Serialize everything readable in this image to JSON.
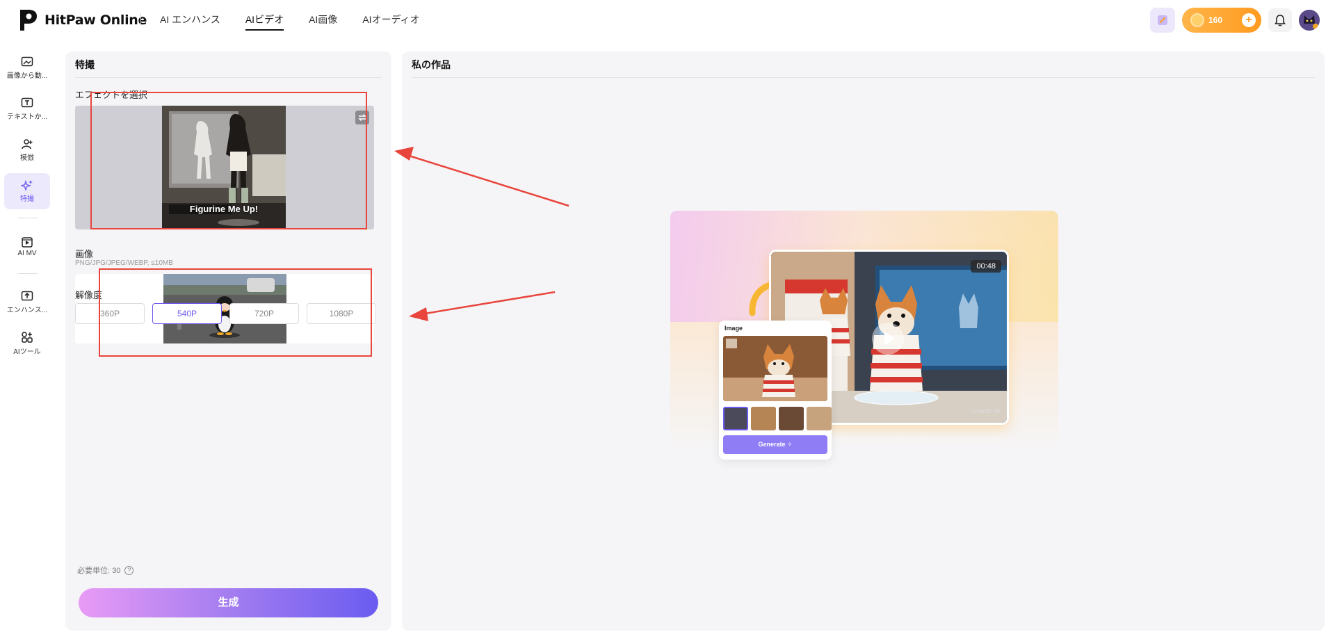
{
  "app": {
    "brand": "HitPaw Online"
  },
  "nav": {
    "items": [
      {
        "label": "AI エンハンス"
      },
      {
        "label": "AIビデオ"
      },
      {
        "label": "AI画像"
      },
      {
        "label": "AIオーディオ"
      }
    ],
    "active_index": 1
  },
  "header": {
    "credits": "160"
  },
  "sidebar": {
    "items": [
      {
        "label": "画像から動...",
        "icon": "image-to-video-icon"
      },
      {
        "label": "テキストか...",
        "icon": "text-to-video-icon"
      },
      {
        "label": "模倣",
        "icon": "imitate-icon"
      },
      {
        "label": "特撮",
        "icon": "sparkle-effects-icon"
      },
      {
        "label": "AI MV",
        "icon": "ai-mv-icon"
      },
      {
        "label": "エンハンス...",
        "icon": "enhance-icon"
      },
      {
        "label": "AIツール",
        "icon": "ai-tools-icon"
      }
    ],
    "active_index": 3
  },
  "left_panel": {
    "title": "特撮",
    "effect_label": "エフェクトを選択",
    "effect_name": "Figurine Me Up!",
    "image_label": "画像",
    "format_note": "PNG/JPG/JPEG/WEBP, ≤10MB",
    "resolution_label": "解像度",
    "resolutions": [
      "360P",
      "540P",
      "720P",
      "1080P"
    ],
    "resolution_selected": "540P",
    "cost": "必要単位: 30",
    "generate": "生成"
  },
  "right_panel": {
    "title": "私の作品",
    "showcase": {
      "video_time": "00:48",
      "video_progress": "00:06/00:48",
      "image_card_title": "Image",
      "image_card_button": "Generate"
    }
  },
  "colors": {
    "accent": "#6c5bf0",
    "annotation": "#e8453c",
    "credits": "#ff9a1f"
  }
}
